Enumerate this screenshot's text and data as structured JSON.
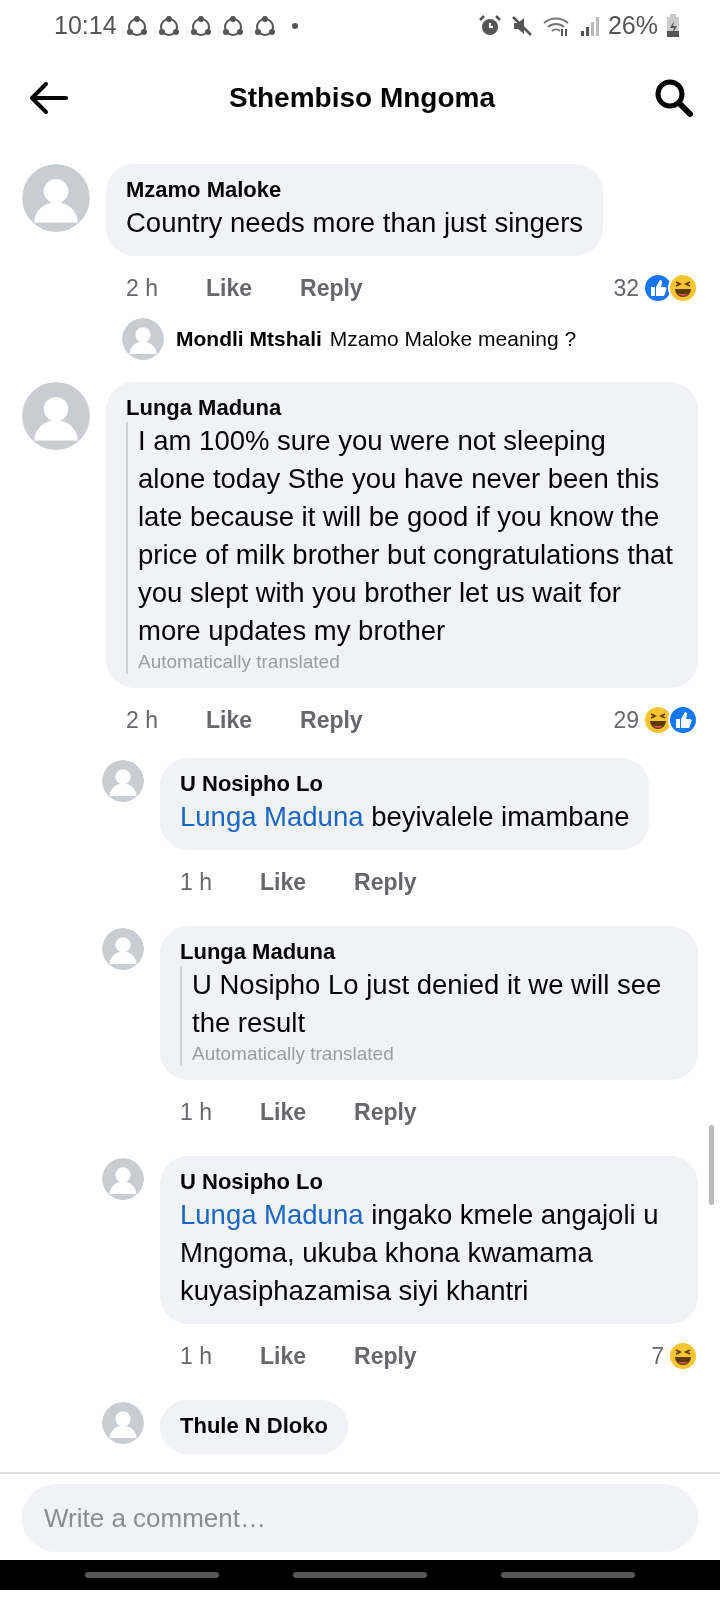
{
  "status_bar": {
    "time": "10:14",
    "battery": "26%"
  },
  "header": {
    "title": "Sthembiso Mngoma"
  },
  "comments": [
    {
      "author": "Mzamo Maloke",
      "text": "Country needs more than just singers",
      "time": "2 h",
      "like": "Like",
      "reply": "Reply",
      "reaction_count": "32",
      "reactions": [
        {
          "kind": "like"
        },
        {
          "kind": "haha"
        }
      ],
      "reply_preview": {
        "author": "Mondli Mtshali",
        "text": "Mzamo Maloke meaning ?"
      }
    },
    {
      "author": "Lunga Maduna",
      "text": "I am 100% sure you were not sleeping alone today Sthe you have never been this late because it will be good if you know the price of milk brother but congratulations that you slept with you brother let us wait for more updates my brother",
      "translation_note": "Automatically translated",
      "time": "2 h",
      "like": "Like",
      "reply": "Reply",
      "reaction_count": "29",
      "reactions": [
        {
          "kind": "haha"
        },
        {
          "kind": "like"
        }
      ],
      "children": [
        {
          "author": "U Nosipho Lo",
          "mention": "Lunga Maduna",
          "text": "beyivalele imambane",
          "time": "1 h",
          "like": "Like",
          "reply": "Reply"
        },
        {
          "author": "Lunga Maduna",
          "text": "U Nosipho Lo just denied it we will see the result",
          "translation_note": "Automatically translated",
          "time": "1 h",
          "like": "Like",
          "reply": "Reply"
        },
        {
          "author": "U Nosipho Lo",
          "mention": "Lunga Maduna",
          "text": "ingako kmele angajoli u Mngoma, ukuba khona kwamama kuyasiphazamisa siyi khantri",
          "time": "1 h",
          "like": "Like",
          "reply": "Reply",
          "reaction_count": "7",
          "reactions": [
            {
              "kind": "haha"
            }
          ]
        },
        {
          "author": "Thule N Dloko"
        }
      ]
    }
  ],
  "composer": {
    "placeholder": "Write a comment…"
  }
}
